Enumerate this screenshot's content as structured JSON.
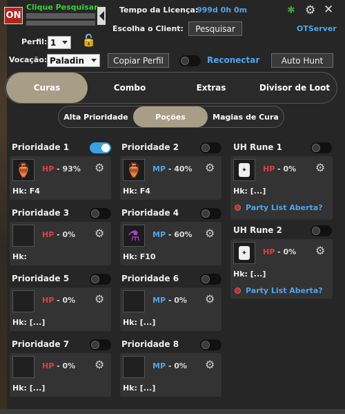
{
  "header": {
    "on_label": "ON",
    "click_search": "Clique Pesquisar",
    "license_label": "Tempo da Licença:",
    "license_value": "999d 0h 0m",
    "client_label": "Escolha o Client:",
    "search_button": "Pesquisar",
    "server": "OTServer",
    "icons": [
      "bug-icon",
      "gear-icon",
      "close-icon",
      "lock-icon"
    ]
  },
  "profile": {
    "label": "Perfil:",
    "value": "1",
    "vocation_label": "Vocação:",
    "vocation_value": "Paladin",
    "copy_button": "Copiar Perfil",
    "reconnect_label": "Reconectar",
    "autohunt_button": "Auto Hunt"
  },
  "tabs": [
    "Curas",
    "Combo",
    "Extras",
    "Divisor de Loot"
  ],
  "active_tab": "Curas",
  "subtabs": [
    "Alta Prioridade",
    "Poções",
    "Magias de Cura"
  ],
  "active_subtab": "Poções",
  "priorities": [
    {
      "title": "Prioridade 1",
      "enabled": true,
      "type": "HP",
      "value": "93%",
      "hotkey": "Hk: F4",
      "item": "supreme-health-potion"
    },
    {
      "title": "Prioridade 2",
      "enabled": false,
      "type": "MP",
      "value": "40%",
      "hotkey": "Hk: F4",
      "item": "supreme-health-potion"
    },
    {
      "title": "Prioridade 3",
      "enabled": false,
      "type": "HP",
      "value": "0%",
      "hotkey": "Hk:",
      "item": "empty"
    },
    {
      "title": "Prioridade 4",
      "enabled": false,
      "type": "MP",
      "value": "60%",
      "hotkey": "Hk: F10",
      "item": "mana-potion"
    },
    {
      "title": "Prioridade 5",
      "enabled": false,
      "type": "HP",
      "value": "0%",
      "hotkey": "Hk: [...]",
      "item": "empty"
    },
    {
      "title": "Prioridade 6",
      "enabled": false,
      "type": "MP",
      "value": "0%",
      "hotkey": "Hk: [...]",
      "item": "empty"
    },
    {
      "title": "Prioridade 7",
      "enabled": false,
      "type": "HP",
      "value": "0%",
      "hotkey": "Hk: [...]",
      "item": "empty"
    },
    {
      "title": "Prioridade 8",
      "enabled": false,
      "type": "MP",
      "value": "0%",
      "hotkey": "Hk: [...]",
      "item": "empty"
    }
  ],
  "runes": [
    {
      "title": "UH Rune 1",
      "enabled": false,
      "type": "HP",
      "value": "0%",
      "hotkey": "Hk: [...]",
      "party": "Party List Aberta?"
    },
    {
      "title": "UH Rune 2",
      "enabled": false,
      "type": "HP",
      "value": "0%",
      "hotkey": "Hk: [...]",
      "party": "Party List Aberta?"
    }
  ],
  "colors": {
    "accent": "#a89d86",
    "toggle_on": "#3aa0e0",
    "hp": "#e04040",
    "mp": "#4fa6ea",
    "on_button": "#b4261d"
  }
}
